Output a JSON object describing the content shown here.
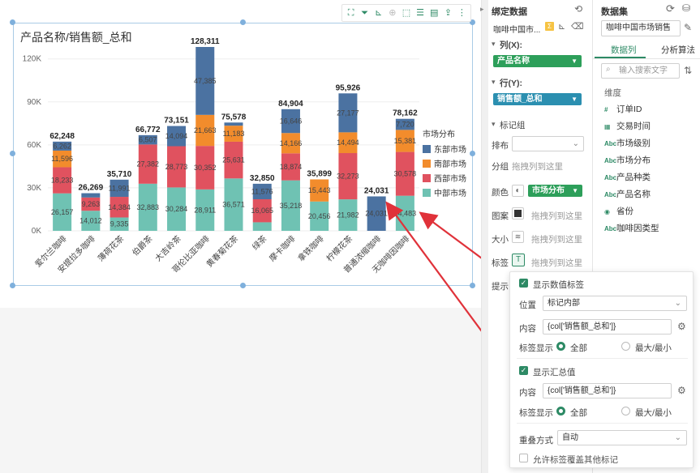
{
  "chart_data": {
    "type": "bar",
    "stacked": true,
    "title": "产品名称/销售额_总和",
    "categories": [
      "爱尔兰咖啡",
      "安提拉多咖啡",
      "薄荷花茶",
      "伯爵茶",
      "大吉岭茶",
      "哥伦比亚咖啡",
      "黄春菊花茶",
      "绿茶",
      "摩卡咖啡",
      "拿铁咖啡",
      "柠檬花茶",
      "普通浓缩咖啡",
      "无咖啡因咖啡"
    ],
    "series": [
      {
        "name": "中部市场",
        "color": "#6fc2b3",
        "values": [
          26157,
          14012,
          9335,
          32883,
          30284,
          28911,
          36571,
          5970,
          35218,
          20456,
          21982,
          0,
          24483
        ],
        "labels": [
          "26,157",
          "14,012",
          "9,335",
          "32,883",
          "30,284",
          "28,911",
          "36,571",
          "",
          "35,218",
          "20,456",
          "21,982",
          "",
          "24,483"
        ]
      },
      {
        "name": "西部市场",
        "color": "#e0525f",
        "values": [
          18233,
          9263,
          14384,
          27382,
          28773,
          30352,
          25631,
          16065,
          18874,
          0,
          32273,
          0,
          30578
        ],
        "labels": [
          "18,233",
          "9,263",
          "14,384",
          "27,382",
          "28,773",
          "30,352",
          "25,631",
          "16,065",
          "18,874",
          "",
          "32,273",
          "",
          "30,578"
        ]
      },
      {
        "name": "南部市场",
        "color": "#f28c2c",
        "values": [
          11596,
          0,
          0,
          0,
          0,
          21663,
          11183,
          0,
          14166,
          15443,
          14494,
          0,
          15381
        ],
        "labels": [
          "11,596",
          "",
          "",
          "",
          "",
          "21,663",
          "11,183",
          "",
          "14,166",
          "15,443",
          "14,494",
          "",
          "15,381"
        ]
      },
      {
        "name": "东部市场",
        "color": "#4b72a1",
        "values": [
          6262,
          2994,
          11991,
          6507,
          14094,
          47385,
          2193,
          10815,
          16646,
          0,
          27177,
          24031,
          7720
        ],
        "labels": [
          "6,262",
          "",
          "11,991",
          "6,507",
          "14,094",
          "47,385",
          "",
          "11,576",
          "16,646",
          "",
          "27,177",
          "24,031",
          "7,720"
        ]
      }
    ],
    "totals": [
      "62,248",
      "26,269",
      "35,710",
      "66,772",
      "73,151",
      "128,311",
      "75,578",
      "32,850",
      "84,904",
      "35,899",
      "95,926",
      "24,031",
      "78,162"
    ],
    "yticks": [
      "0K",
      "30K",
      "60K",
      "90K",
      "120K"
    ],
    "ylim": [
      0,
      130000
    ],
    "legend_title": "市场分布",
    "legend_position": "right"
  },
  "bind_panel": {
    "title": "绑定数据",
    "dataset_short": "咖啡中国市...",
    "columns_label": "列(X):",
    "columns_value": "产品名称",
    "rows_label": "行(Y):",
    "rows_value": "销售额_总和",
    "marks_label": "标记组",
    "sort_label": "排布",
    "group_label": "分组",
    "group_drop": "拖拽列到这里",
    "color_label": "颜色",
    "color_value": "市场分布",
    "shape_label": "图案",
    "shape_drop": "拖拽列到这里",
    "size_label": "大小",
    "size_drop": "拖拽列到这里",
    "label_label": "标签",
    "label_drop": "拖拽列到这里",
    "tip_label": "提示"
  },
  "dataset_panel": {
    "title": "数据集",
    "dataset_name": "咖啡中国市场销售",
    "tab_columns": "数据列",
    "tab_algorithms": "分析算法",
    "search_placeholder": "输入搜索文字",
    "dimension_label": "维度",
    "fields": [
      {
        "icon": "#",
        "name": "订单ID"
      },
      {
        "icon": "▦",
        "name": "交易时间"
      },
      {
        "icon": "Abc",
        "name": "市场级别"
      },
      {
        "icon": "Abc",
        "name": "市场分布"
      },
      {
        "icon": "Abc",
        "name": "产品种类"
      },
      {
        "icon": "Abc",
        "name": "产品名称"
      },
      {
        "icon": "◉",
        "name": "省份"
      },
      {
        "icon": "Abc",
        "name": "咖啡因类型"
      }
    ]
  },
  "popup": {
    "show_value_label": "显示数值标签",
    "position_label": "位置",
    "position_value": "标记内部",
    "content_label": "内容",
    "content_value": "{col['销售额_总和']}",
    "label_display": "标签显示",
    "opt_all": "全部",
    "opt_maxmin": "最大/最小",
    "show_total": "显示汇总值",
    "total_content_label": "内容",
    "total_content_value": "{col['销售额_总和']}",
    "total_label_display": "标签显示",
    "total_opt_all": "全部",
    "total_opt_maxmin": "最大/最小",
    "overlap_label": "重叠方式",
    "overlap_value": "自动",
    "allow_overlap": "允许标签覆盖其他标记"
  },
  "colors": {
    "accent": "#2d8a65",
    "pill_blue": "#2b8fb0",
    "arrow": "#e0323a"
  }
}
